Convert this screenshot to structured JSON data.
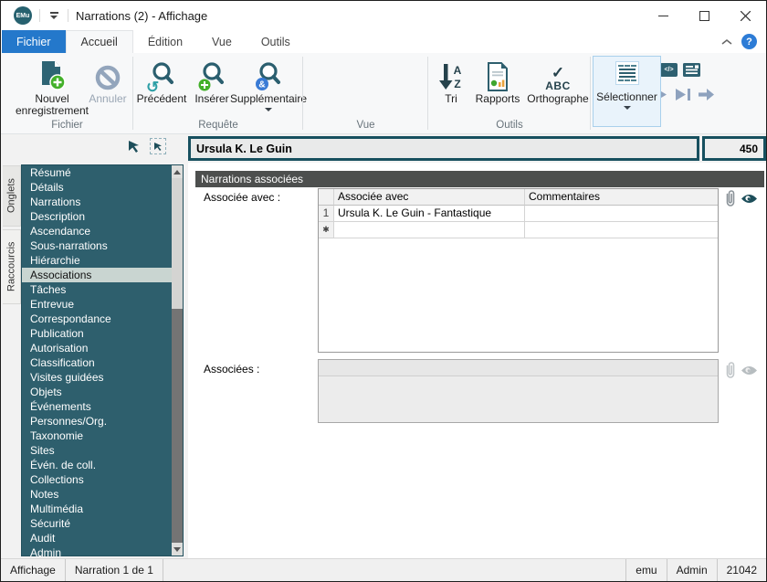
{
  "window": {
    "title": "Narrations (2) - Affichage"
  },
  "glyphs": {
    "app_badge": "EMu",
    "help": "?",
    "new_row": "✱",
    "code": "</>",
    "amp": "&",
    "abc": "ABC",
    "check": "✓",
    "sort_a": "A",
    "sort_z": "Z",
    "undo_swirl": "↺"
  },
  "menu": {
    "file_tab": "Fichier",
    "tabs": [
      "Accueil",
      "Édition",
      "Vue",
      "Outils"
    ],
    "active_tab": "Accueil"
  },
  "ribbon": {
    "new_record": "Nouvel enregistrement",
    "cancel": "Annuler",
    "previous": "Précédent",
    "insert": "Insérer",
    "additional": "Supplémentaire",
    "sort": "Tri",
    "reports": "Rapports",
    "spelling": "Orthographe",
    "select": "Sélectionner",
    "group_labels": {
      "file": "Fichier",
      "query": "Requête",
      "view": "Vue",
      "tools": "Outils"
    }
  },
  "record": {
    "title": "Ursula K. Le Guin",
    "number": "450"
  },
  "side_tabs": {
    "tabs_label": "Onglets",
    "shortcuts_label": "Raccourcis"
  },
  "sidebar": {
    "selected": "Associations",
    "items": [
      "Résumé",
      "Détails",
      "Narrations",
      "Description",
      "Ascendance",
      "Sous-narrations",
      "Hiérarchie",
      "Associations",
      "Tâches",
      "Entrevue",
      "Correspondance",
      "Publication",
      "Autorisation",
      "Classification",
      "Visites guidées",
      "Objets",
      "Événements",
      "Personnes/Org.",
      "Taxonomie",
      "Sites",
      "Évén. de coll.",
      "Collections",
      "Notes",
      "Multimédia",
      "Sécurité",
      "Audit",
      "Admin"
    ]
  },
  "main": {
    "section_title": "Narrations associées",
    "associated_with_label": "Associée avec :",
    "associated_label": "Associées :",
    "table": {
      "col_assoc": "Associée avec",
      "col_comments": "Commentaires",
      "row1": {
        "num": "1",
        "assoc": "Ursula K. Le Guin - Fantastique",
        "comments": ""
      }
    }
  },
  "status": {
    "mode": "Affichage",
    "record_info": "Narration 1 de 1",
    "server": "emu",
    "user": "Admin",
    "port": "21042"
  },
  "colors": {
    "teal": "#2E5F6D",
    "teal_dark": "#17505F",
    "blue_tab": "#2478CB",
    "section_header": "#4D4F4E",
    "green_accent": "#43B02A",
    "blue_accent": "#3A7BD5"
  }
}
